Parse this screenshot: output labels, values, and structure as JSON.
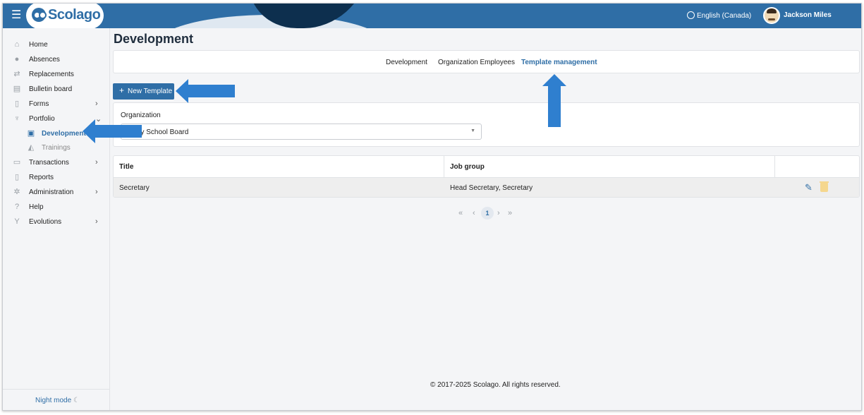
{
  "header": {
    "logo_text": "Scolago",
    "language": "English (Canada)",
    "user_name": "Jackson Miles"
  },
  "sidebar": {
    "items": [
      {
        "label": "Home",
        "icon": "home-icon"
      },
      {
        "label": "Absences",
        "icon": "user-absence-icon"
      },
      {
        "label": "Replacements",
        "icon": "replacement-icon"
      },
      {
        "label": "Bulletin board",
        "icon": "bulletin-board-icon"
      },
      {
        "label": "Forms",
        "icon": "form-icon",
        "has_children": true
      },
      {
        "label": "Portfolio",
        "icon": "trophy-icon",
        "expanded": true
      },
      {
        "label": "Development",
        "icon": "development-icon",
        "active": true
      },
      {
        "label": "Trainings",
        "icon": "graduation-cap-icon"
      },
      {
        "label": "Transactions",
        "icon": "transactions-icon",
        "has_children": true
      },
      {
        "label": "Reports",
        "icon": "report-icon"
      },
      {
        "label": "Administration",
        "icon": "gear-icon",
        "has_children": true
      },
      {
        "label": "Help",
        "icon": "help-icon"
      },
      {
        "label": "Evolutions",
        "icon": "evolution-icon",
        "has_children": true
      }
    ],
    "night_mode": "Night mode"
  },
  "main": {
    "title": "Development",
    "tabs": [
      {
        "label": "Development",
        "active": false
      },
      {
        "label": "Organization Employees",
        "active": false
      },
      {
        "label": "Template management",
        "active": true
      }
    ],
    "new_button": "New Template",
    "organization": {
      "label": "Organization",
      "selected": "y Sky School Board"
    },
    "table": {
      "columns": [
        "Title",
        "Job group"
      ],
      "rows": [
        {
          "title": "Secretary",
          "job_group": "Head Secretary, Secretary"
        }
      ]
    },
    "pagination": {
      "current_page": "1",
      "first": "«",
      "prev": "‹",
      "next": "›",
      "last": "»"
    }
  },
  "footer": {
    "copyright": "© 2017-2025 Scolago. All rights reserved."
  },
  "colors": {
    "primary": "#2f6ea6",
    "annotation_arrow": "#2f7fcf",
    "delete_icon": "#f5d78e"
  }
}
